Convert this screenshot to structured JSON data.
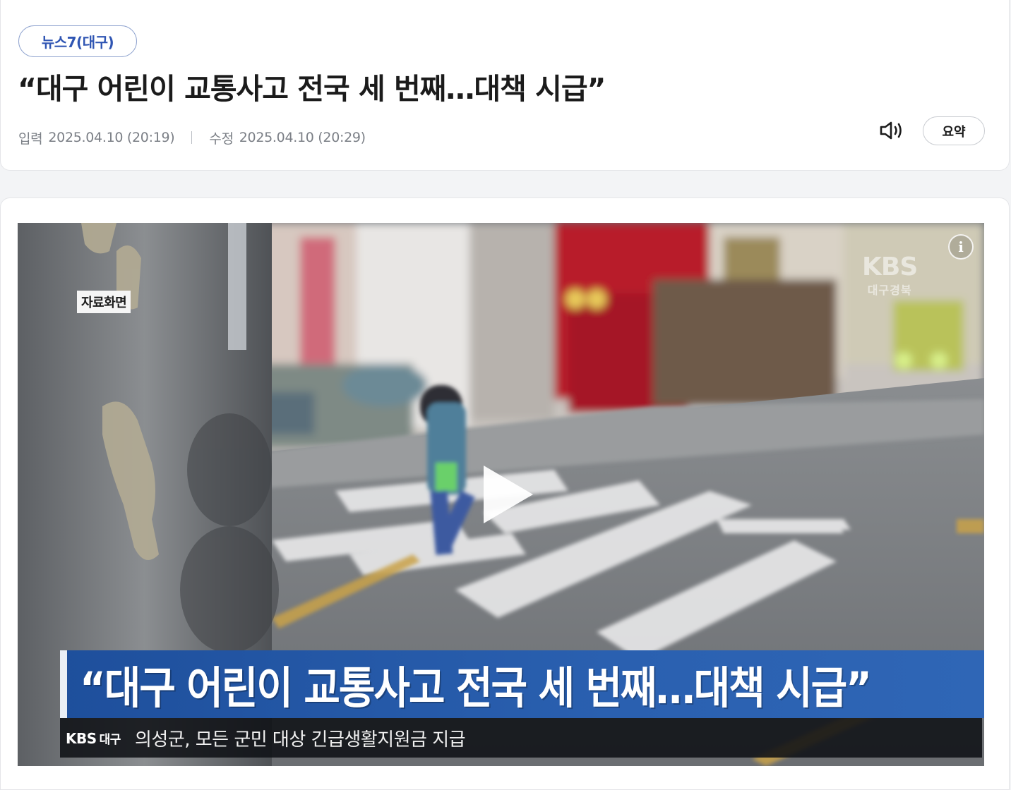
{
  "article": {
    "program_tag": "뉴스7(대구)",
    "headline": "“대구 어린이 교통사고 전국 세 번째…대책 시급”",
    "input_label": "입력",
    "input_time": "2025.04.10 (20:19)",
    "modified_label": "수정",
    "modified_time": "2025.04.10 (20:29)",
    "summary_button": "요약",
    "speaker_icon": "speaker-icon"
  },
  "video": {
    "caption_tag": "자료화면",
    "info_button": "i",
    "watermark_main": "KBS",
    "watermark_sub": "대구경북",
    "banner_title": "“대구 어린이 교통사고 전국 세 번째…대책 시급”",
    "ticker_logo": "KBS",
    "ticker_region": "대구",
    "ticker_text": "의성군, 모든 군민 대상 긴급생활지원금 지급",
    "play_icon": "play-icon",
    "colors": {
      "banner_blue": "#1e4f9c",
      "ticker_bg": "#0f1116"
    }
  },
  "colors": {
    "tag_text": "#2f55b3",
    "headline_text": "#1b1b1b",
    "meta_text": "#7b7f86"
  }
}
